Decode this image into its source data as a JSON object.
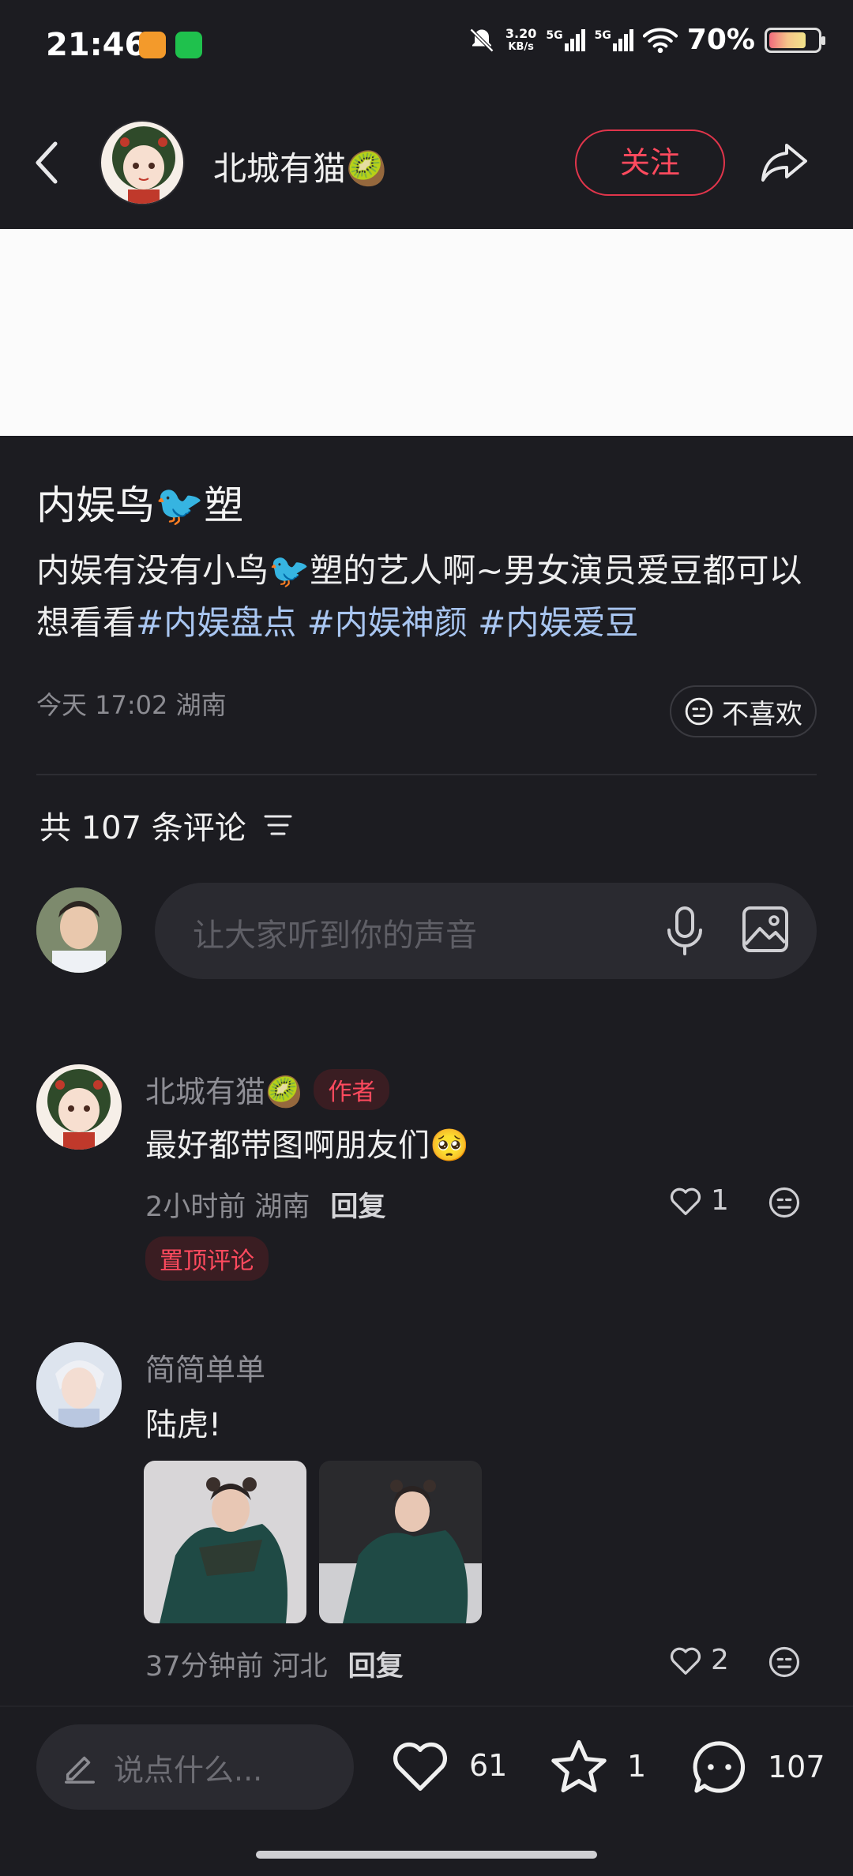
{
  "status_bar": {
    "time": "21:46",
    "net_speed_value": "3.20",
    "net_speed_unit": "KB/s",
    "signal1_label": "5G",
    "signal2_label": "5G",
    "battery_percent": "70%",
    "battery_level": 0.7
  },
  "header": {
    "user_name": "北城有猫🥝",
    "follow_label": "关注"
  },
  "post": {
    "title": "内娱鸟🐦塑",
    "body_text": "内娱有没有小鸟🐦塑的艺人啊~男女演员爱豆都可以 想看看",
    "tags": [
      "#内娱盘点",
      "#内娱神颜",
      "#内娱爱豆"
    ],
    "meta": "今天 17:02 湖南",
    "dislike_label": "不喜欢"
  },
  "comments_section": {
    "count_label": "共 107 条评论",
    "input_placeholder": "让大家听到你的声音"
  },
  "comments": [
    {
      "author": "北城有猫🥝",
      "badge": "作者",
      "text": "最好都带图啊朋友们🥺",
      "meta": "2小时前 湖南",
      "reply_label": "回复",
      "likes": "1",
      "pinned_label": "置顶评论"
    },
    {
      "author": "简简单单",
      "text": "陆虎!",
      "meta": "37分钟前 河北",
      "reply_label": "回复",
      "likes": "2"
    }
  ],
  "bottom_bar": {
    "say_placeholder": "说点什么...",
    "like_count": "61",
    "star_count": "1",
    "comment_count": "107"
  },
  "colors": {
    "accent": "#ff4a5e",
    "background": "#1c1c21",
    "tag": "#a9c6f1"
  }
}
